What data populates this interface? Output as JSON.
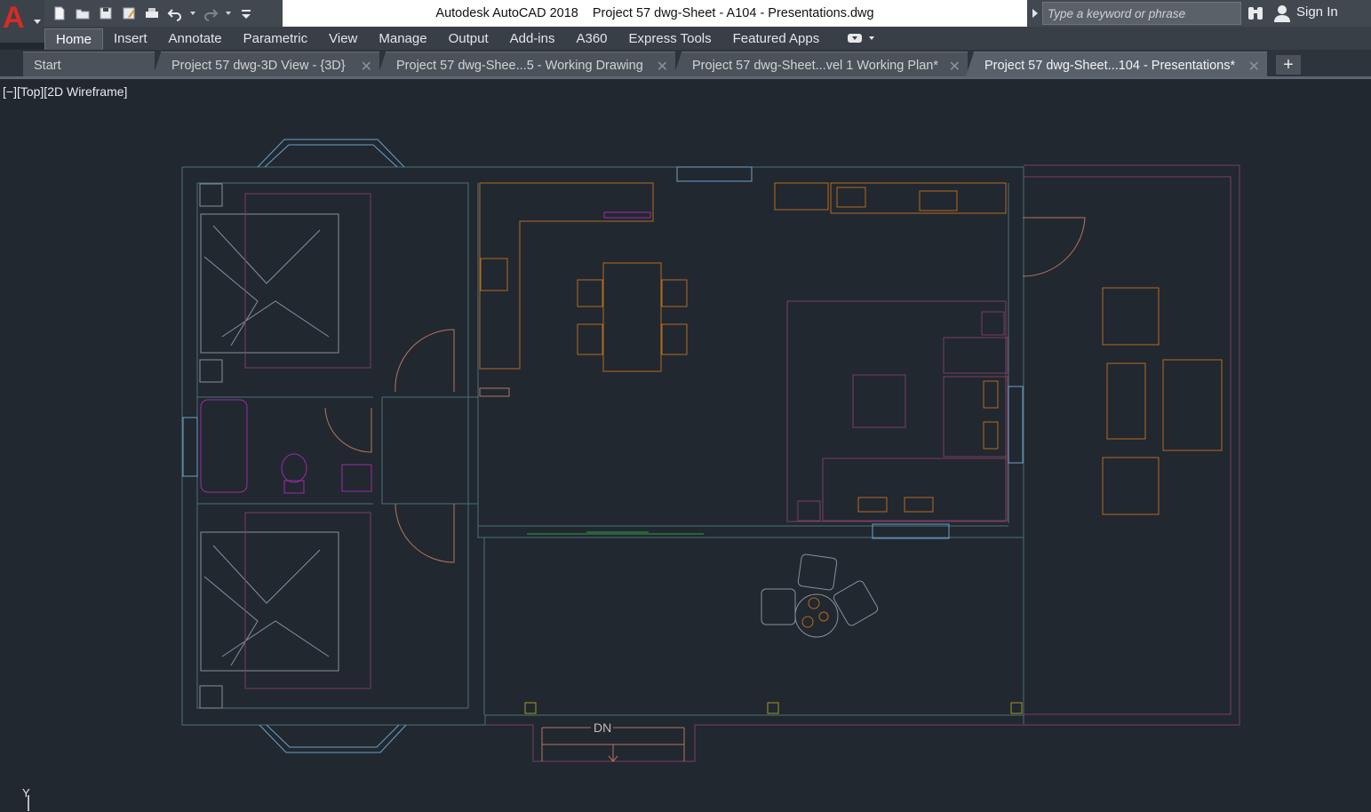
{
  "window": {
    "app_name": "Autodesk AutoCAD 2018",
    "document_title": "Project 57 dwg-Sheet - A104 - Presentations.dwg"
  },
  "quick_access": [
    {
      "name": "new-icon"
    },
    {
      "name": "open-icon"
    },
    {
      "name": "save-icon"
    },
    {
      "name": "save-as-icon"
    },
    {
      "name": "plot-icon"
    },
    {
      "name": "undo-icon"
    },
    {
      "name": "redo-icon"
    },
    {
      "name": "customize-icon"
    }
  ],
  "search": {
    "placeholder": "Type a keyword or phrase"
  },
  "account": {
    "sign_in_label": "Sign In"
  },
  "ribbon": {
    "tabs": [
      "Home",
      "Insert",
      "Annotate",
      "Parametric",
      "View",
      "Manage",
      "Output",
      "Add-ins",
      "A360",
      "Express Tools",
      "Featured Apps"
    ],
    "active_tab": "Home"
  },
  "file_tabs": [
    "Start",
    "Project 57 dwg-3D View - {3D}",
    "Project 57 dwg-Shee...5 - Working Drawing",
    "Project 57 dwg-Sheet...vel 1 Working Plan*",
    "Project 57 dwg-Sheet...104 - Presentations*"
  ],
  "active_file_tab": "Project 57 dwg-Sheet...104 - Presentations*",
  "viewport": {
    "controls_label": "[−][Top][2D Wireframe]",
    "stair_label": "DN",
    "ucs_axis_label": "Y"
  },
  "colors": {
    "background": "#212830",
    "wall": "#4a6f77",
    "furniture": "#b56a1f",
    "bed": "#8a8f99",
    "bathroom": "#a02aa6",
    "window": "#6fa0c8",
    "outline_pink": "#7a3e5f",
    "brand_red": "#d72b26"
  }
}
